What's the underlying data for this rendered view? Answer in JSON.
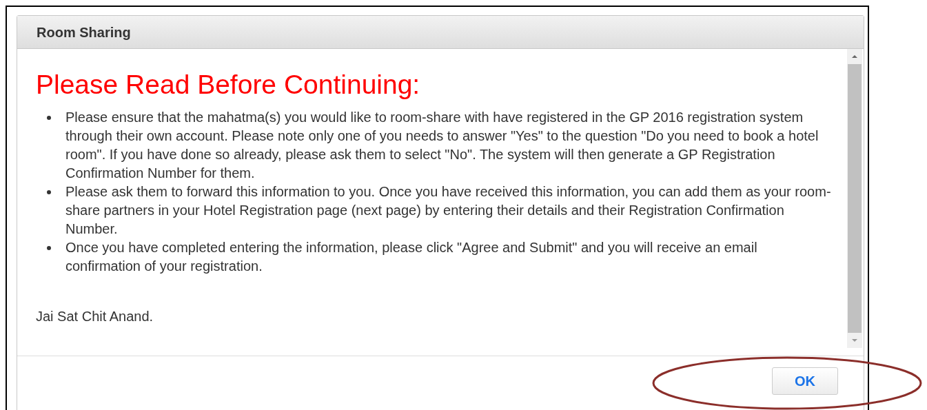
{
  "dialog": {
    "title": "Room Sharing",
    "heading": "Please Read Before Continuing:",
    "bullets": [
      "Please ensure that the mahatma(s) you would like to room-share with have registered in the GP 2016 registration system through their own account. Please note only one of you needs to answer \"Yes\" to the question \"Do you need to book a hotel room\". If you have done so already, please ask them to select \"No\". The system will then generate a GP Registration Confirmation Number for them.",
      "Please ask them to forward this information to you. Once you have received this information, you can add them as your room-share partners in your Hotel Registration page (next page) by entering their details and their Registration Confirmation Number.",
      "Once you have completed entering the information, please click \"Agree and Submit\" and you will receive an email confirmation of your registration."
    ],
    "closing": "Jai Sat Chit Anand.",
    "buttons": [
      "OK"
    ]
  }
}
